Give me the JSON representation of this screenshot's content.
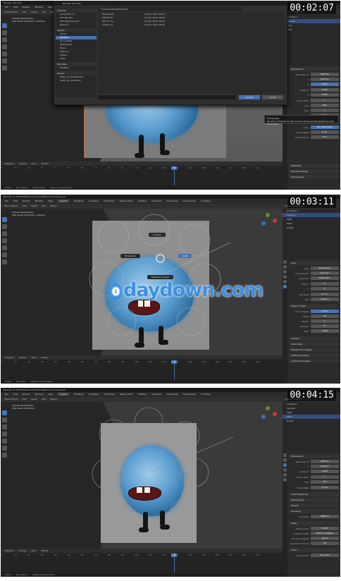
{
  "colors": {
    "accent": "#4772b3",
    "background": "#3d3d3d",
    "watermark": "#3d8fe0"
  },
  "watermark": {
    "text": "daydown.com",
    "icon": "drop-logo"
  },
  "frames": [
    {
      "timestamp": "00:02:07",
      "titlebar": "Blender File View",
      "menubar": {
        "items": [
          "File",
          "Edit",
          "Render",
          "Window",
          "Help",
          "Layout"
        ]
      },
      "viewport_header": {
        "items": [
          "Object Mode",
          "View",
          "Select",
          "Add",
          "Object"
        ]
      },
      "camera_info": {
        "line1": "Camera Perspective",
        "line2": "(26) Scene Collection | Camera"
      },
      "file_browser": {
        "path": "C:\\Users\\Default\\Desktop\\",
        "volumes_title": "Volumes",
        "volumes": [
          "Local Disk (C:)",
          "Storage (D:)",
          "DVD RW Drive (E:)",
          "Data (F:)"
        ],
        "system_title": "System",
        "system": [
          "Home",
          "Desktop",
          "Documents",
          "Downloads",
          "Music",
          "Pictures",
          "Videos",
          "Fonts"
        ],
        "favorites_title": "Favorites",
        "favorites": [
          "Desktop"
        ],
        "recent_title": "Recent",
        "recent": [
          "0001_1A_Final Render",
          "0001_1A_Animation"
        ],
        "files": [
          {
            "name": "Downloads",
            "date": "12 Dec 2021 16:03"
          },
          {
            "name": "PHOTO 00",
            "date": "12 Dec 2021 16:03"
          },
          {
            "name": "Work 2 (3)",
            "date": "12 Dec 2021 16:03"
          },
          {
            "name": "Videos (1)",
            "date": "12 Dec 2021 16:03"
          }
        ],
        "accept_label": "Accept",
        "cancel_label": "Cancel"
      },
      "tooltip": {
        "title": "Frame Rate",
        "text": "Number of frames to skip forward while rendering/playing back each frame"
      },
      "outliner": {
        "title": "Scene Collection",
        "items": [
          "Collection",
          "Camera",
          "Light",
          "Mesh"
        ]
      },
      "properties": {
        "sections": [
          "Dimensions",
          "Output",
          "Metadata",
          "Post Processing",
          "Stereoscopy"
        ],
        "rows": [
          {
            "label": "Resolution X",
            "value": "1080 px"
          },
          {
            "label": "Y",
            "value": "1920 px"
          },
          {
            "label": "%",
            "value": "100%"
          },
          {
            "label": "Aspect X",
            "value": "1.000"
          },
          {
            "label": "Y",
            "value": "1.000"
          },
          {
            "label": "Frame Start",
            "value": "1"
          },
          {
            "label": "End",
            "value": "250"
          },
          {
            "label": "Step",
            "value": "1"
          },
          {
            "label": "Frame Rate",
            "value": "24 fps"
          },
          {
            "label": "Color",
            "value": "BW RGB RGBA"
          },
          {
            "label": "Color Depth",
            "value": "8 16"
          },
          {
            "label": "Compression",
            "value": "15%"
          }
        ]
      },
      "timeline": {
        "header": [
          "Playback",
          "Keying",
          "View",
          "Marker"
        ],
        "ticks": [
          "0",
          "10",
          "20",
          "30",
          "40",
          "50",
          "60",
          "70",
          "80",
          "90",
          "100",
          "110",
          "120",
          "130",
          "140",
          "150",
          "160",
          "170",
          "180",
          "190"
        ],
        "current_frame": "126"
      },
      "statusbar": [
        "Select",
        "Box Select",
        "Rotate View",
        "Object Context Menu"
      ]
    },
    {
      "timestamp": "00:03:11",
      "titlebar": "Blender [C:\\FOLDER\\Monkey\\Finished\\Monster_Final.blend]",
      "menubar": {
        "items": [
          "File",
          "Edit",
          "Render",
          "Window",
          "Help",
          "Layout",
          "Modeling",
          "Sculpting",
          "UV Editing",
          "Texture Paint",
          "Shading",
          "Animation",
          "Rendering",
          "Compositing",
          "Scripting"
        ]
      },
      "viewport_header": {
        "items": [
          "Object Mode",
          "View",
          "Select",
          "Add",
          "Object"
        ]
      },
      "camera_info": {
        "line1": "Camera Perspective",
        "line2": "(26) Scene Collection | Camera"
      },
      "pie_menu": {
        "items": [
          "Camera",
          "Wireframe",
          "Material Preview",
          "Solid"
        ],
        "highlighted": "Solid"
      },
      "outliner": {
        "title": "Scene Collection",
        "items": [
          "Collection",
          "Camera",
          "Light",
          "Mesh",
          "Empty"
        ]
      },
      "properties": {
        "sections": [
          "Lens",
          "Depth of Field",
          "Camera",
          "Safe Areas",
          "Background Images",
          "Viewport Display",
          "Custom Properties"
        ],
        "rows": [
          {
            "label": "Type",
            "value": "Perspective"
          },
          {
            "label": "Focal Length",
            "value": "100 mm"
          },
          {
            "label": "Lens Unit",
            "value": "Millimeters"
          },
          {
            "label": "Shift X",
            "value": "0"
          },
          {
            "label": "Y",
            "value": "0"
          },
          {
            "label": "Clip Start",
            "value": "0.1 m"
          },
          {
            "label": "End",
            "value": "1000 m"
          },
          {
            "label": "Focus Object",
            "value": "Empty"
          },
          {
            "label": "F-Stop",
            "value": "2.8"
          },
          {
            "label": "Blades",
            "value": "0"
          },
          {
            "label": "Rotation",
            "value": "0°"
          },
          {
            "label": "Ratio",
            "value": "1.000"
          }
        ]
      },
      "timeline": {
        "header": [
          "Playback",
          "Keying",
          "View",
          "Marker"
        ],
        "ticks": [
          "0",
          "10",
          "20",
          "30",
          "40",
          "50",
          "60",
          "70",
          "80",
          "90",
          "100",
          "110",
          "120",
          "130",
          "140",
          "150",
          "160",
          "170",
          "180",
          "190"
        ],
        "current_frame": "126"
      },
      "statusbar": [
        "Select",
        "Pan View",
        "Object Context Menu"
      ]
    },
    {
      "timestamp": "00:04:15",
      "titlebar": "Blender [C:\\FOLDER\\Monkey\\Finished\\Monster_Final.blend]",
      "menubar": {
        "items": [
          "File",
          "Edit",
          "Render",
          "Window",
          "Help",
          "Layout",
          "Modeling",
          "Sculpting",
          "UV Editing",
          "Texture Paint",
          "Shading",
          "Animation",
          "Rendering",
          "Compositing",
          "Scripting"
        ]
      },
      "viewport_header": {
        "items": [
          "Object Mode",
          "View",
          "Select",
          "Add",
          "Object"
        ]
      },
      "camera_info": {
        "line1": "Camera Perspective",
        "line2": "(26) Scene Collection"
      },
      "outliner": {
        "title": "Scene Collection",
        "items": [
          "Collection",
          "Camera",
          "Light",
          "Mesh",
          "Empty"
        ]
      },
      "properties": {
        "sections": [
          "Dimensions",
          "Time Stretching",
          "Stereoscopy",
          "Output",
          "Encoding",
          "Video",
          "Audio"
        ],
        "rows": [
          {
            "label": "Resolution X",
            "value": "1080 px"
          },
          {
            "label": "Y",
            "value": "1920 px"
          },
          {
            "label": "Aspect X",
            "value": "1.000"
          },
          {
            "label": "Frame Start",
            "value": "1"
          },
          {
            "label": "End",
            "value": "250"
          },
          {
            "label": "Frame Rate",
            "value": "24 fps"
          },
          {
            "label": "Container",
            "value": "MPEG-4"
          },
          {
            "label": "Video Codec",
            "value": "H.264"
          },
          {
            "label": "Output Quality",
            "value": "Medium Quality"
          },
          {
            "label": "Encoding Speed",
            "value": "Good"
          },
          {
            "label": "Keyframe Interval",
            "value": "18"
          },
          {
            "label": "Audio Codec",
            "value": "No Audio"
          }
        ]
      },
      "timeline": {
        "header": [
          "Playback",
          "Keying",
          "View",
          "Marker"
        ],
        "ticks": [
          "0",
          "10",
          "20",
          "30",
          "40",
          "50",
          "60",
          "70",
          "80",
          "90",
          "100",
          "110",
          "120",
          "130",
          "140",
          "150",
          "160",
          "170",
          "180",
          "190"
        ],
        "current_frame": "126"
      },
      "statusbar": [
        "Select",
        "Box Select",
        "Object Context Menu"
      ]
    }
  ]
}
